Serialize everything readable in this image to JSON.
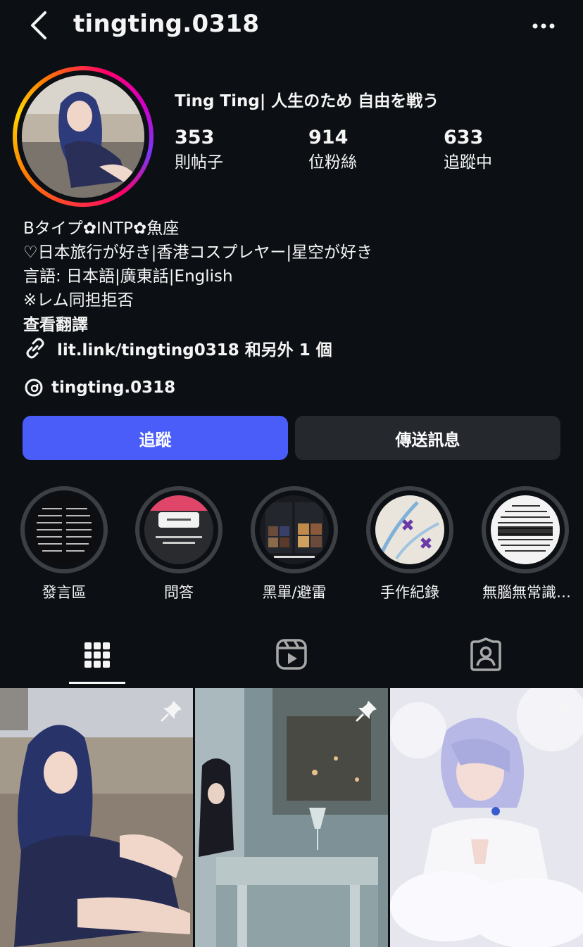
{
  "header": {
    "username": "tingting.0318",
    "back_icon": "chevron-left-icon",
    "more_icon": "more-horizontal-icon"
  },
  "profile": {
    "display_name": "Ting Ting| 人生のため 自由を戦う",
    "stats": [
      {
        "value": "353",
        "label": "則帖子"
      },
      {
        "value": "914",
        "label": "位粉絲"
      },
      {
        "value": "633",
        "label": "追蹤中"
      }
    ],
    "bio_lines": [
      "Bタイプ✿INTP✿魚座",
      "♡日本旅行が好き|香港コスプレヤー|星空が好き",
      "言語: 日本語|廣東話|English",
      "※レム同担拒否"
    ],
    "see_translation": "查看翻譯",
    "link_text": "lit.link/tingting0318 和另外 1 個",
    "threads_handle": "tingting.0318"
  },
  "actions": {
    "follow_label": "追蹤",
    "message_label": "傳送訊息"
  },
  "highlights": [
    {
      "label": "發言區"
    },
    {
      "label": "問答"
    },
    {
      "label": "黑單/避雷"
    },
    {
      "label": "手作紀錄"
    },
    {
      "label": "無腦無常識…"
    }
  ],
  "tabs": [
    {
      "icon": "grid-icon",
      "selected": true
    },
    {
      "icon": "reels-icon",
      "selected": false
    },
    {
      "icon": "tagged-icon",
      "selected": false
    }
  ],
  "posts": [
    {
      "pinned": true
    },
    {
      "pinned": true
    },
    {
      "pinned": true
    }
  ],
  "colors": {
    "background": "#0c1014",
    "follow_button": "#4a5df9",
    "message_button": "#25292e",
    "text": "#f5f5f5"
  }
}
